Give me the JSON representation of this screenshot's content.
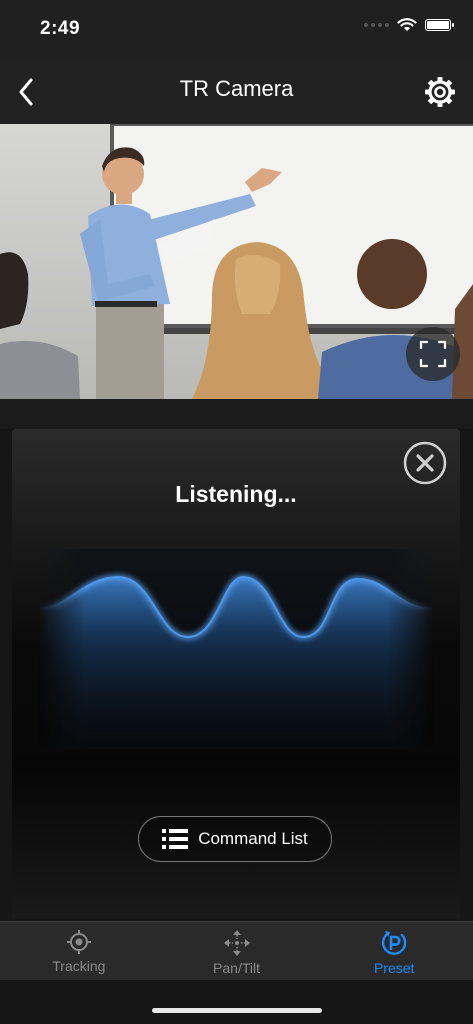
{
  "status_bar": {
    "time": "2:49",
    "wifi_icon": "wifi-icon",
    "battery_icon": "battery-icon",
    "battery_level": 1.0
  },
  "nav": {
    "title": "TR Camera",
    "back_icon": "chevron-left-icon",
    "settings_icon": "gear-icon"
  },
  "camera": {
    "fullscreen_icon": "fullscreen-icon"
  },
  "voice": {
    "status_text": "Listening...",
    "close_icon": "close-circle-icon",
    "command_list_label": "Command List",
    "command_list_icon": "list-icon"
  },
  "tabs": [
    {
      "label": "Tracking",
      "icon": "crosshair-icon",
      "active": false
    },
    {
      "label": "Pan/Tilt",
      "icon": "move-arrows-icon",
      "active": false
    },
    {
      "label": "Preset",
      "icon": "preset-p-icon",
      "active": true
    }
  ],
  "colors": {
    "accent": "#1a8cff",
    "wave": "#3b8fe0",
    "background": "#161616"
  }
}
